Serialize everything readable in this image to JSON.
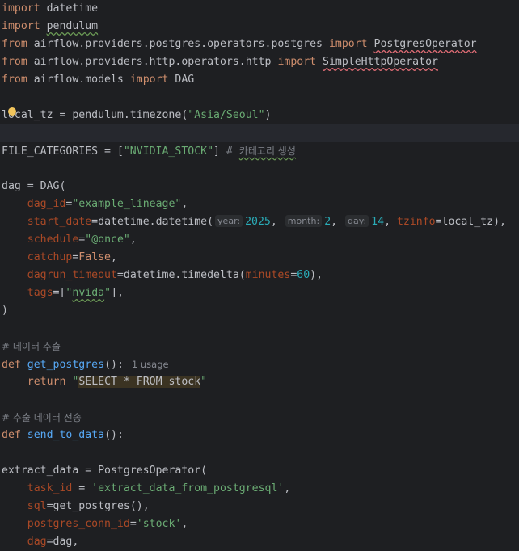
{
  "editor": {
    "imports": [
      {
        "kw": "import",
        "mod": "datetime"
      },
      {
        "kw": "import",
        "mod": "pendulum"
      }
    ],
    "from_imports": [
      {
        "from": "from",
        "mod": "airflow.providers.postgres.operators.postgres",
        "imp": "import",
        "name": "PostgresOperator"
      },
      {
        "from": "from",
        "mod": "airflow.providers.http.operators.http",
        "imp": "import",
        "name": "SimpleHttpOperator"
      },
      {
        "from": "from",
        "mod": "airflow.models",
        "imp": "import",
        "name": "DAG"
      }
    ],
    "local_tz": {
      "prefix": "local_tz = pendulum.timezone(",
      "arg": "\"Asia/Seoul\"",
      "suffix": ")"
    },
    "file_categories": {
      "prefix": "FILE_CATEGORIES = [",
      "value": "\"NVIDIA_STOCK\"",
      "suffix": "]",
      "comment_hash": "#",
      "comment_text": "카테고리 생성"
    },
    "dag": {
      "open": "dag = DAG(",
      "dag_id_key": "dag_id",
      "dag_id_val": "\"example_lineage\"",
      "start_date_key": "start_date",
      "start_date_call": "datetime.datetime(",
      "hint_year": "year:",
      "year": "2025",
      "hint_month": "month:",
      "month": "2",
      "hint_day": "day:",
      "day": "14",
      "tzinfo_key": "tzinfo",
      "tzinfo_val": "local_tz",
      "schedule_key": "schedule",
      "schedule_val": "\"@once\"",
      "catchup_key": "catchup",
      "catchup_val": "False",
      "dagrun_timeout_key": "dagrun_timeout",
      "timedelta_call": "datetime.timedelta(",
      "minutes_key": "minutes",
      "minutes_val": "60",
      "tags_key": "tags",
      "tags_val": "nvida",
      "close": ")"
    },
    "comment_extract": "# 데이터 추출",
    "get_postgres": {
      "def": "def",
      "name": "get_postgres",
      "sig": "():",
      "usage": "1 usage",
      "return_kw": "return",
      "sql": "SELECT * FROM stock"
    },
    "comment_send": "# 추출 데이터 전송",
    "send_to_data": {
      "def": "def",
      "name": "send_to_data",
      "sig": "():"
    },
    "extract_data": {
      "open": "extract_data = PostgresOperator(",
      "task_id_key": "task_id",
      "task_id_val": "'extract_data_from_postgresql'",
      "sql_key": "sql",
      "sql_val": "get_postgres(),",
      "conn_key": "postgres_conn_id",
      "conn_val": "'stock'",
      "dag_key": "dag",
      "dag_val": "dag,"
    }
  }
}
